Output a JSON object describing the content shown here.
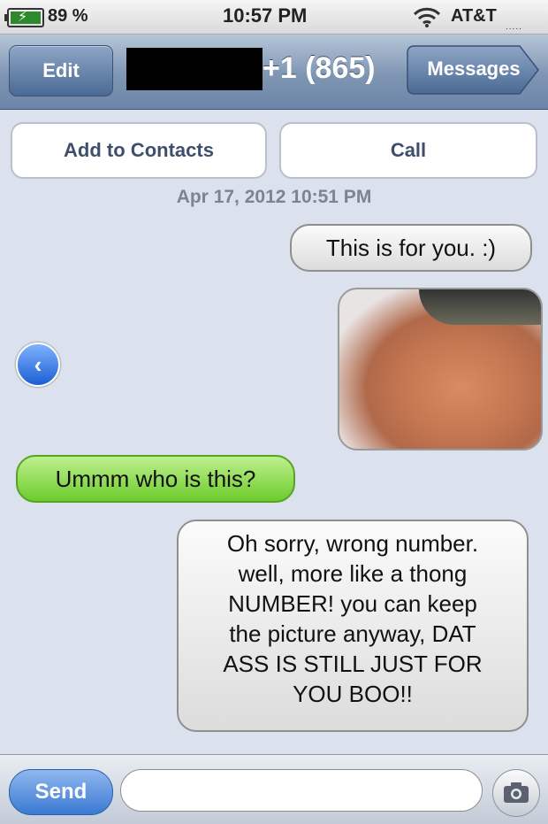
{
  "status_bar": {
    "battery_percent": "89 %",
    "time": "10:57 PM",
    "carrier": "AT&T",
    "icons": [
      "battery-charging-icon",
      "wifi-icon"
    ]
  },
  "nav_bar": {
    "edit_label": "Edit",
    "title": "+1 (865)",
    "back_label": "Messages"
  },
  "actions": {
    "add_to_contacts": "Add to Contacts",
    "call": "Call"
  },
  "conversation": {
    "timestamp": "Apr 17, 2012 10:51 PM",
    "messages": [
      {
        "side": "right",
        "color": "gray",
        "lines": [
          "This is for you. :)"
        ]
      },
      {
        "side": "right",
        "type": "photo"
      },
      {
        "side": "left",
        "color": "green",
        "lines": [
          "Ummm who is this?"
        ]
      },
      {
        "side": "right",
        "color": "gray",
        "lines": [
          "Oh sorry, wrong number.",
          "well, more like a thong",
          "NUMBER! you can keep",
          "the picture anyway, DAT",
          "ASS IS STILL JUST FOR",
          "YOU BOO!!"
        ]
      }
    ]
  },
  "compose": {
    "send_label": "Send",
    "input_value": "",
    "input_placeholder": ""
  },
  "colors": {
    "nav_bar": "#7e95b3",
    "sent_bubble": "#6ccb2c",
    "received_bubble": "#e8e8e8",
    "background": "#dbe2ed"
  }
}
